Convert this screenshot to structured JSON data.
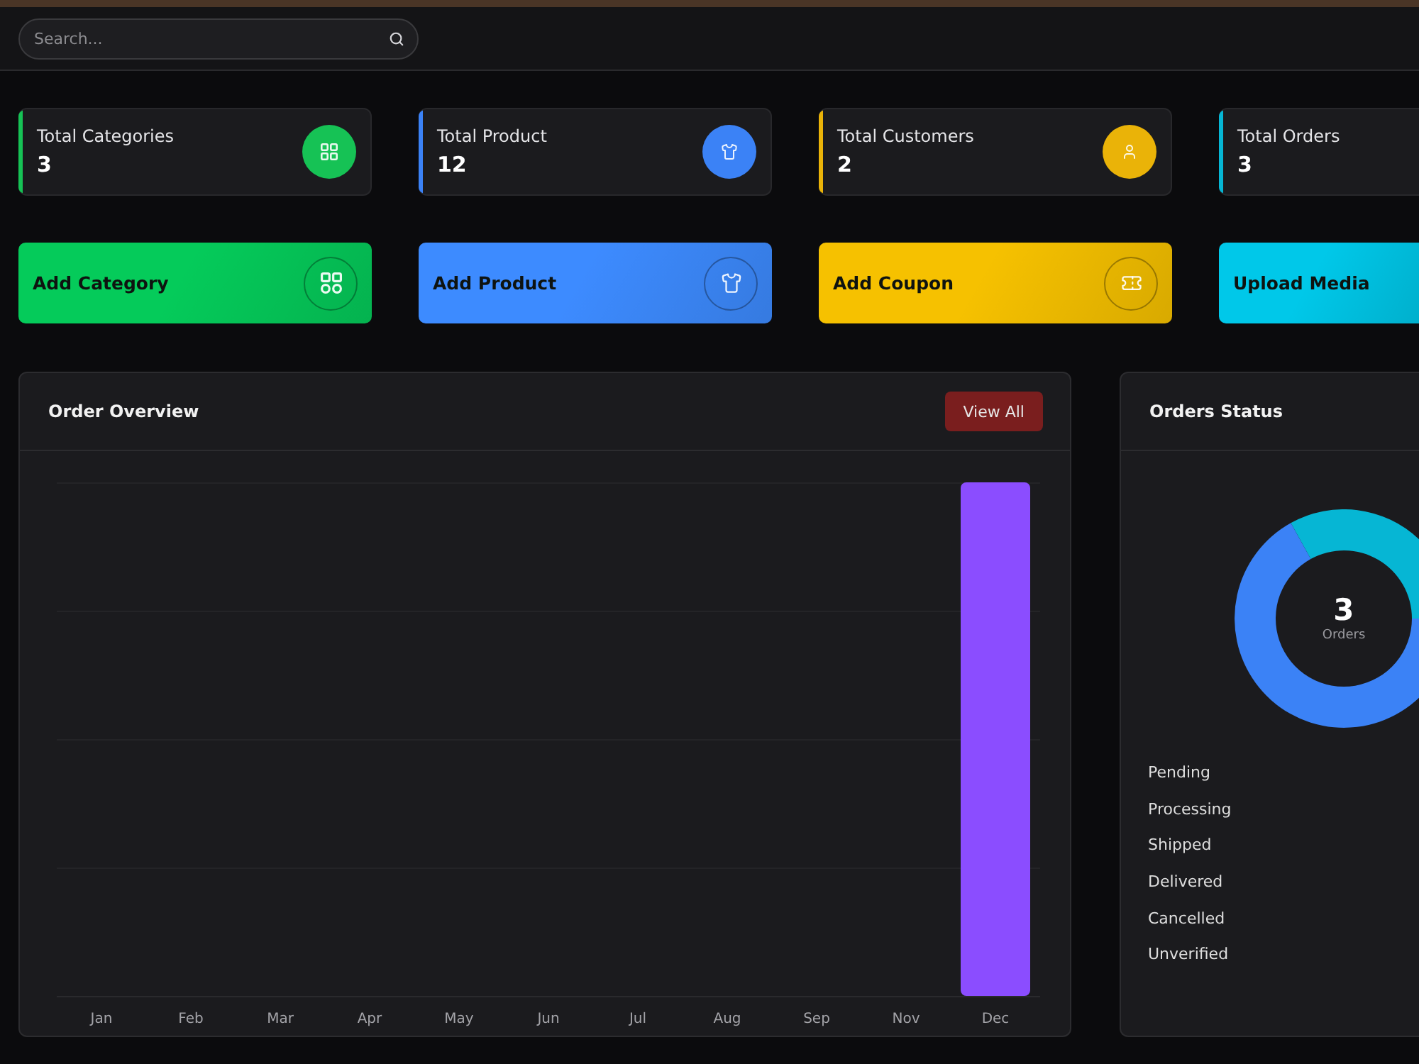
{
  "header": {
    "search": {
      "placeholder": "Search..."
    }
  },
  "stats": [
    {
      "title": "Total Categories",
      "value": "3",
      "color": "#16c255"
    },
    {
      "title": "Total Product",
      "value": "12",
      "color": "#3b82f6"
    },
    {
      "title": "Total Customers",
      "value": "2",
      "color": "#eab308"
    },
    {
      "title": "Total Orders",
      "value": "3",
      "color": "#06b6d4"
    }
  ],
  "actions": [
    {
      "label": "Add Category",
      "color": "#05cb5a"
    },
    {
      "label": "Add Product",
      "color": "#3d8bff"
    },
    {
      "label": "Add Coupon",
      "color": "#f6c100"
    },
    {
      "label": "Upload Media",
      "color": "#00c8e9"
    }
  ],
  "order_overview": {
    "title": "Order Overview",
    "button": "View All",
    "x_labels": [
      "Jan",
      "Feb",
      "Mar",
      "Apr",
      "May",
      "Jun",
      "Jul",
      "Aug",
      "Sep",
      "Nov",
      "Dec"
    ]
  },
  "orders_status": {
    "title": "Orders Status",
    "total": "3",
    "total_label": "Orders",
    "legend": [
      "Pending",
      "Processing",
      "Shipped",
      "Delivered",
      "Cancelled",
      "Unverified"
    ]
  }
}
